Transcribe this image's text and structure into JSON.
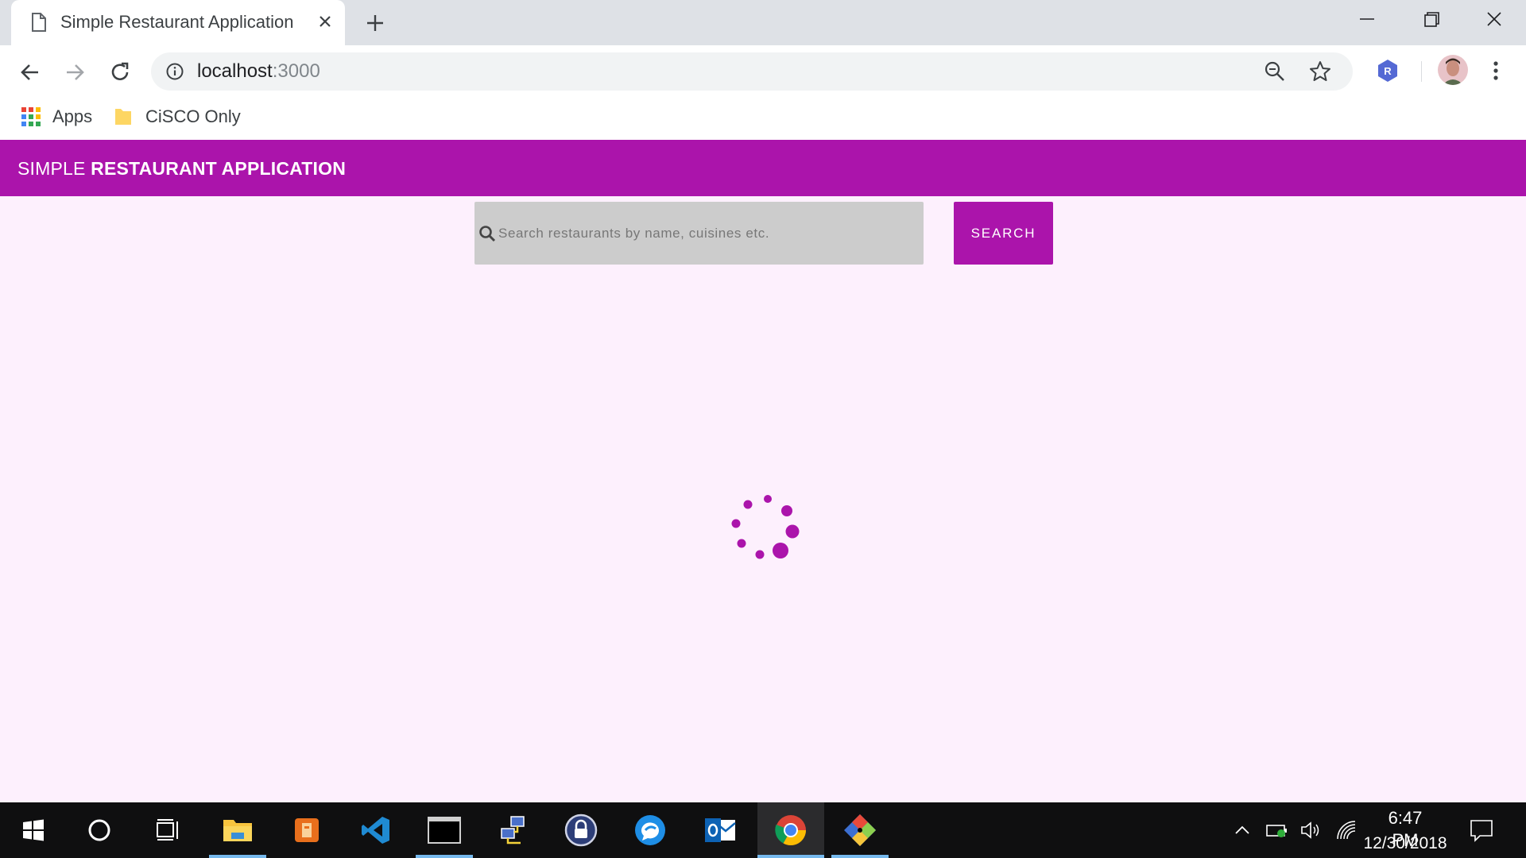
{
  "browser": {
    "tab_title": "Simple Restaurant Application",
    "url_host": "localhost",
    "url_port": ":3000",
    "bookmarks": [
      {
        "label": "Apps",
        "icon": "apps-grid-icon"
      },
      {
        "label": "CiSCO Only",
        "icon": "folder-icon"
      }
    ],
    "extension_badge": "R"
  },
  "app": {
    "title_light": "SIMPLE ",
    "title_bold": "RESTAURANT APPLICATION",
    "search_placeholder": "Search restaurants by name, cuisines etc.",
    "search_button": "SEARCH",
    "loading": true
  },
  "taskbar": {
    "apps": [
      "start",
      "cortana",
      "task-view",
      "file-explorer",
      "office",
      "vscode",
      "terminal",
      "network",
      "keepass",
      "teams",
      "outlook",
      "chrome",
      "git"
    ],
    "active_app": "chrome",
    "time": "6:47 PM",
    "date": "12/30/2018"
  },
  "colors": {
    "accent": "#ab14ab",
    "page_background": "#fdf0fd",
    "search_field": "#cccccc"
  }
}
